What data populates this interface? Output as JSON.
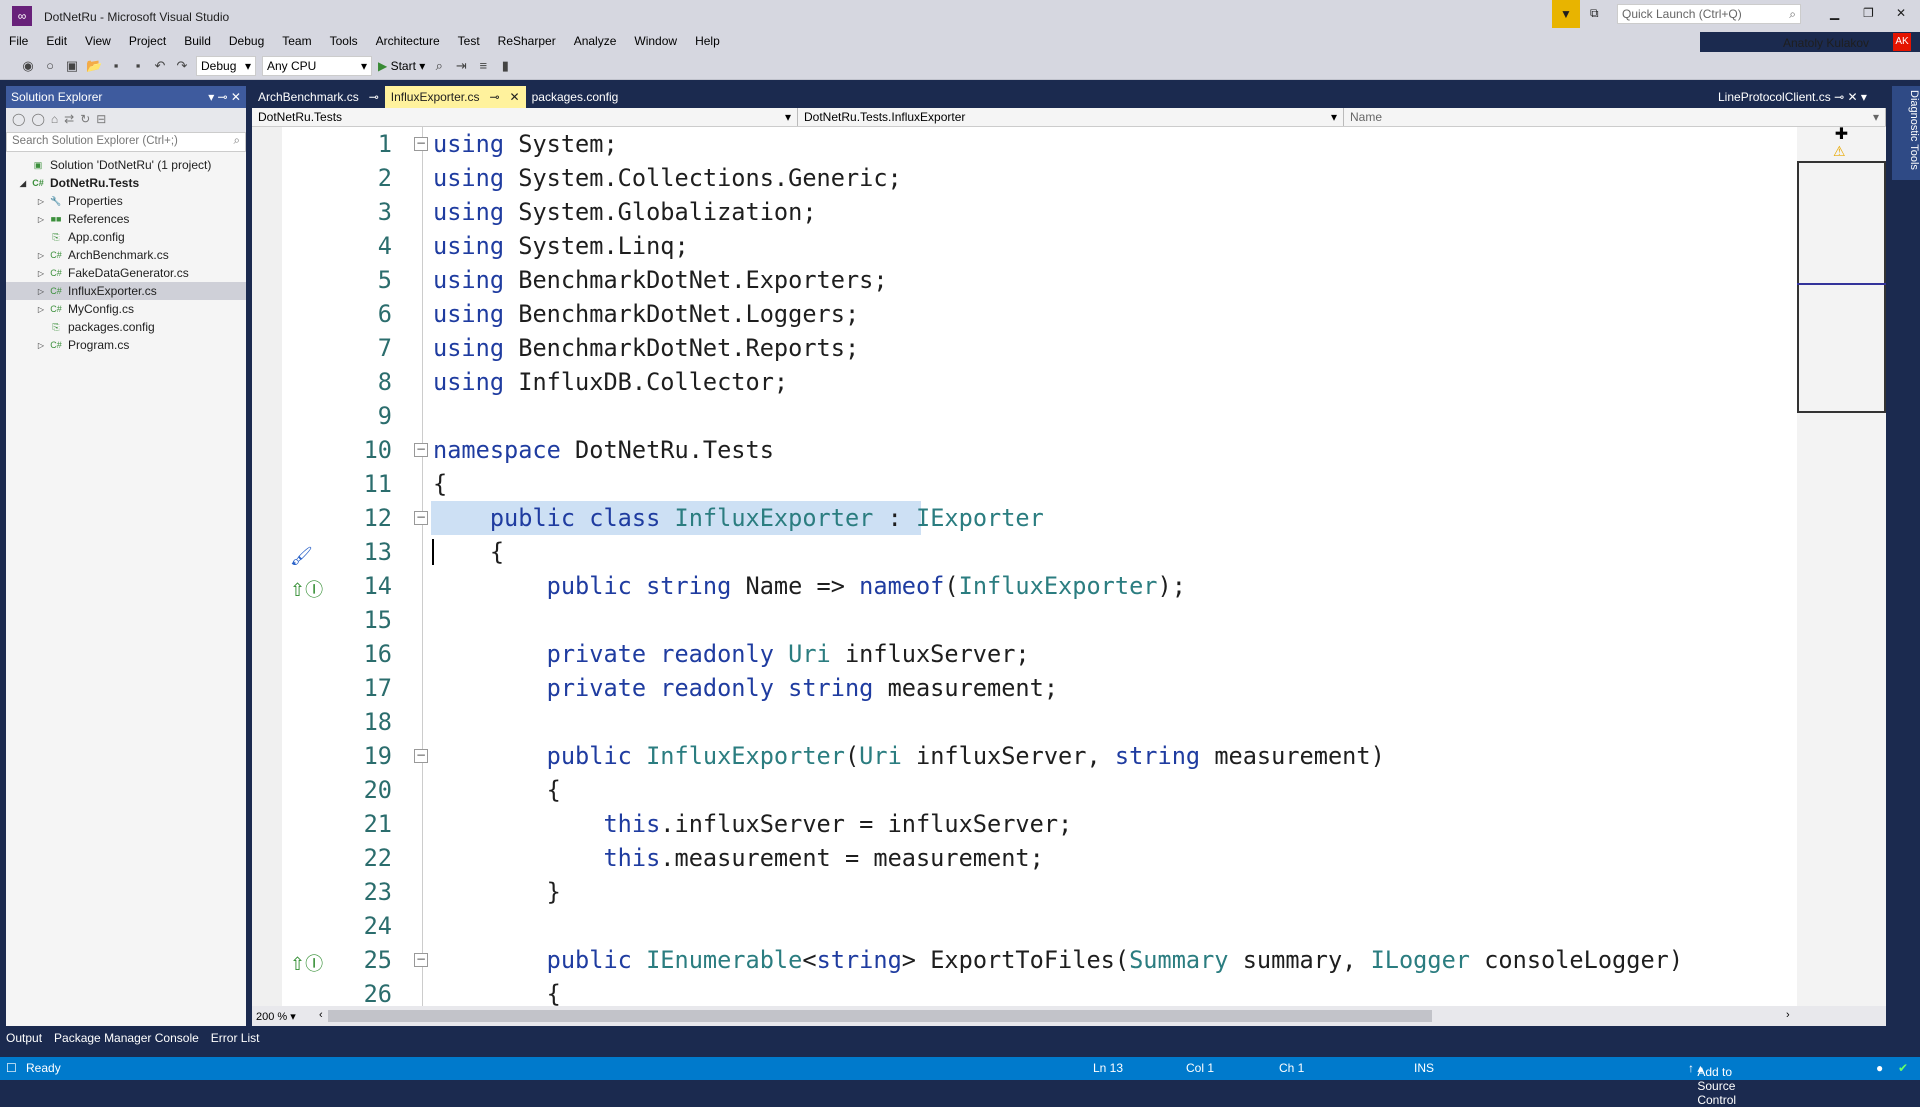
{
  "window": {
    "title": "DotNetRu - Microsoft Visual Studio",
    "quick_launch_placeholder": "Quick Launch (Ctrl+Q)",
    "user": "Anatoly Kulakov",
    "user_initials": "AK"
  },
  "menu": [
    "File",
    "Edit",
    "View",
    "Project",
    "Build",
    "Debug",
    "Team",
    "Tools",
    "Architecture",
    "Test",
    "ReSharper",
    "Analyze",
    "Window",
    "Help"
  ],
  "toolbar": {
    "configuration": "Debug",
    "platform": "Any CPU",
    "start_label": "Start"
  },
  "solution_explorer": {
    "title": "Solution Explorer",
    "search_placeholder": "Search Solution Explorer (Ctrl+;)",
    "items": [
      {
        "label": "Solution 'DotNetRu' (1 project)",
        "level": 0,
        "expander": "",
        "icon": "solution-icon"
      },
      {
        "label": "DotNetRu.Tests",
        "level": 0,
        "expander": "◢",
        "icon": "csharp-project-icon",
        "bold": true
      },
      {
        "label": "Properties",
        "level": 1,
        "expander": "▷",
        "icon": "wrench-icon"
      },
      {
        "label": "References",
        "level": 1,
        "expander": "▷",
        "icon": "references-icon"
      },
      {
        "label": "App.config",
        "level": 1,
        "expander": "",
        "icon": "config-file-icon"
      },
      {
        "label": "ArchBenchmark.cs",
        "level": 1,
        "expander": "▷",
        "icon": "csharp-file-icon"
      },
      {
        "label": "FakeDataGenerator.cs",
        "level": 1,
        "expander": "▷",
        "icon": "csharp-file-icon"
      },
      {
        "label": "InfluxExporter.cs",
        "level": 1,
        "expander": "▷",
        "icon": "csharp-file-icon",
        "selected": true
      },
      {
        "label": "MyConfig.cs",
        "level": 1,
        "expander": "▷",
        "icon": "csharp-file-icon"
      },
      {
        "label": "packages.config",
        "level": 1,
        "expander": "",
        "icon": "config-file-icon"
      },
      {
        "label": "Program.cs",
        "level": 1,
        "expander": "▷",
        "icon": "csharp-file-icon"
      }
    ]
  },
  "tabs": [
    {
      "label": "ArchBenchmark.cs",
      "pin": "⊸"
    },
    {
      "label": "InfluxExporter.cs",
      "pin": "⊸",
      "active": true,
      "close": "✕"
    },
    {
      "label": "packages.config",
      "pin": ""
    }
  ],
  "preview_tab": "LineProtocolClient.cs",
  "navbar": {
    "project": "DotNetRu.Tests",
    "type": "DotNetRu.Tests.InfluxExporter",
    "member": "Name"
  },
  "code": [
    [
      [
        "k",
        "using"
      ],
      [
        "p",
        " System;"
      ]
    ],
    [
      [
        "k",
        "using"
      ],
      [
        "p",
        " System.Collections.Generic;"
      ]
    ],
    [
      [
        "k",
        "using"
      ],
      [
        "p",
        " System.Globalization;"
      ]
    ],
    [
      [
        "k",
        "using"
      ],
      [
        "p",
        " System.Linq;"
      ]
    ],
    [
      [
        "k",
        "using"
      ],
      [
        "p",
        " BenchmarkDotNet.Exporters;"
      ]
    ],
    [
      [
        "k",
        "using"
      ],
      [
        "p",
        " BenchmarkDotNet.Loggers;"
      ]
    ],
    [
      [
        "k",
        "using"
      ],
      [
        "p",
        " BenchmarkDotNet.Reports;"
      ]
    ],
    [
      [
        "k",
        "using"
      ],
      [
        "p",
        " InfluxDB.Collector;"
      ]
    ],
    [],
    [
      [
        "k",
        "namespace"
      ],
      [
        "p",
        " DotNetRu.Tests"
      ]
    ],
    [
      [
        "p",
        "{"
      ]
    ],
    [
      [
        "p",
        "    "
      ],
      [
        "k",
        "public class "
      ],
      [
        "t",
        "InfluxExporter"
      ],
      [
        "p",
        " : "
      ],
      [
        "t",
        "IExporter"
      ]
    ],
    [
      [
        "p",
        "    {"
      ]
    ],
    [
      [
        "p",
        "        "
      ],
      [
        "k",
        "public string"
      ],
      [
        "p",
        " Name => "
      ],
      [
        "k",
        "nameof"
      ],
      [
        "p",
        "("
      ],
      [
        "t",
        "InfluxExporter"
      ],
      [
        "p",
        ");"
      ]
    ],
    [],
    [
      [
        "p",
        "        "
      ],
      [
        "k",
        "private readonly "
      ],
      [
        "t",
        "Uri"
      ],
      [
        "p",
        " influxServer;"
      ]
    ],
    [
      [
        "p",
        "        "
      ],
      [
        "k",
        "private readonly string"
      ],
      [
        "p",
        " measurement;"
      ]
    ],
    [],
    [
      [
        "p",
        "        "
      ],
      [
        "k",
        "public "
      ],
      [
        "t",
        "InfluxExporter"
      ],
      [
        "p",
        "("
      ],
      [
        "t",
        "Uri"
      ],
      [
        "p",
        " influxServer, "
      ],
      [
        "k",
        "string"
      ],
      [
        "p",
        " measurement)"
      ]
    ],
    [
      [
        "p",
        "        {"
      ]
    ],
    [
      [
        "p",
        "            "
      ],
      [
        "k",
        "this"
      ],
      [
        "p",
        ".influxServer = influxServer;"
      ]
    ],
    [
      [
        "p",
        "            "
      ],
      [
        "k",
        "this"
      ],
      [
        "p",
        ".measurement = measurement;"
      ]
    ],
    [
      [
        "p",
        "        }"
      ]
    ],
    [],
    [
      [
        "p",
        "        "
      ],
      [
        "k",
        "public "
      ],
      [
        "t",
        "IEnumerable"
      ],
      [
        "p",
        "<"
      ],
      [
        "k",
        "string"
      ],
      [
        "p",
        "> ExportToFiles("
      ],
      [
        "t",
        "Summary"
      ],
      [
        "p",
        " summary, "
      ],
      [
        "t",
        "ILogger"
      ],
      [
        "p",
        " consoleLogger)"
      ]
    ],
    [
      [
        "p",
        "        {"
      ]
    ]
  ],
  "folds": [
    1,
    10,
    12,
    19,
    25
  ],
  "highlight_line": 12,
  "caret": {
    "line": 13
  },
  "gutter_icons": [
    {
      "line": 13,
      "icon": "quick-action-brush-icon",
      "glyph": "🖌"
    },
    {
      "line": 14,
      "icon": "implements-interface-icon",
      "glyph": "⇧Ⓘ"
    },
    {
      "line": 25,
      "icon": "implements-interface-icon",
      "glyph": "⇧Ⓘ"
    }
  ],
  "zoom": "200 %",
  "diagnostic_tools": "Diagnostic Tools",
  "bottom_tabs": [
    "Output",
    "Package Manager Console",
    "Error List"
  ],
  "status": {
    "ready": "Ready",
    "ln": "Ln 13",
    "col": "Col 1",
    "ch": "Ch 1",
    "mode": "INS",
    "source_control": "Add to Source Control"
  },
  "colors": {
    "keyword": "#1f3ca0",
    "type": "#2b7d80",
    "status_bar": "#007acc",
    "active_tab": "#fff29d"
  }
}
